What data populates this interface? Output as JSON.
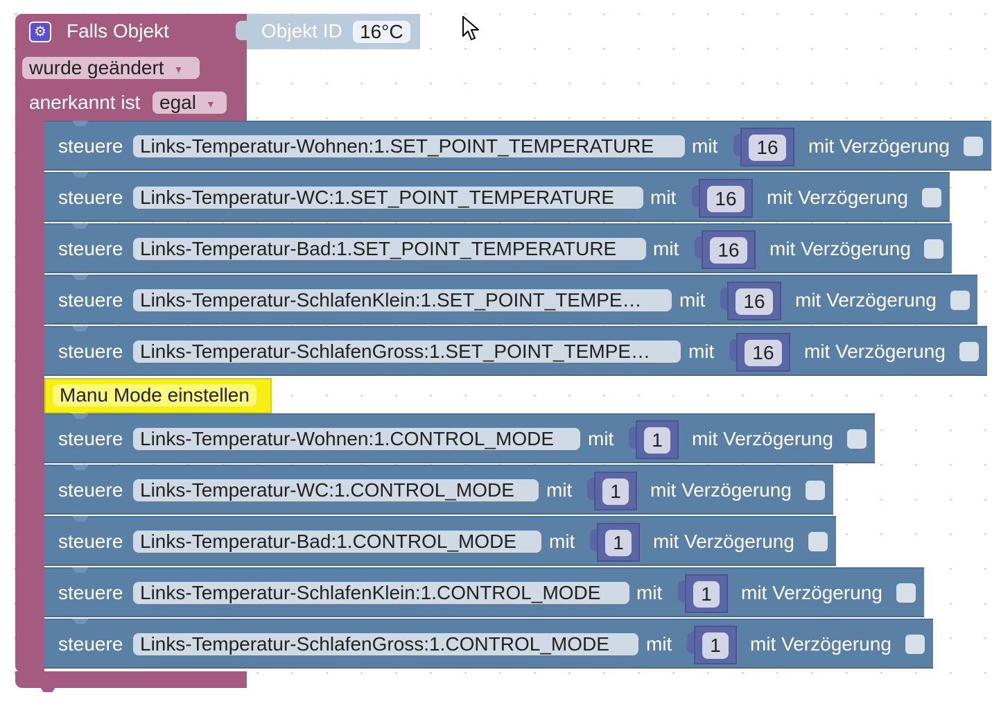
{
  "event_block": {
    "title": "Falls Objekt",
    "settings_icon": "gear-icon",
    "trigger_dropdown": "wurde geändert",
    "ack_label": "anerkannt ist",
    "ack_dropdown": "egal",
    "color": "#a55b80"
  },
  "object_input": {
    "label": "Objekt ID",
    "value": "16°C"
  },
  "comment": {
    "text": "Manu Mode einstellen",
    "color": "#f5f011"
  },
  "setpoint_rows": [
    {
      "verb": "steuere",
      "object_id": "Links-Temperatur-Wohnen:1.SET_POINT_TEMPERATURE",
      "mit": "mit",
      "value": "16",
      "delay_label": "mit Verzögerung"
    },
    {
      "verb": "steuere",
      "object_id": "Links-Temperatur-WC:1.SET_POINT_TEMPERATURE",
      "mit": "mit",
      "value": "16",
      "delay_label": "mit Verzögerung"
    },
    {
      "verb": "steuere",
      "object_id": "Links-Temperatur-Bad:1.SET_POINT_TEMPERATURE",
      "mit": "mit",
      "value": "16",
      "delay_label": "mit Verzögerung"
    },
    {
      "verb": "steuere",
      "object_id": "Links-Temperatur-SchlafenKlein:1.SET_POINT_TEMPE…",
      "mit": "mit",
      "value": "16",
      "delay_label": "mit Verzögerung"
    },
    {
      "verb": "steuere",
      "object_id": "Links-Temperatur-SchlafenGross:1.SET_POINT_TEMPE…",
      "mit": "mit",
      "value": "16",
      "delay_label": "mit Verzögerung"
    }
  ],
  "mode_rows": [
    {
      "verb": "steuere",
      "object_id": "Links-Temperatur-Wohnen:1.CONTROL_MODE",
      "mit": "mit",
      "value": "1",
      "delay_label": "mit Verzögerung"
    },
    {
      "verb": "steuere",
      "object_id": "Links-Temperatur-WC:1.CONTROL_MODE",
      "mit": "mit",
      "value": "1",
      "delay_label": "mit Verzögerung"
    },
    {
      "verb": "steuere",
      "object_id": "Links-Temperatur-Bad:1.CONTROL_MODE",
      "mit": "mit",
      "value": "1",
      "delay_label": "mit Verzögerung"
    },
    {
      "verb": "steuere",
      "object_id": "Links-Temperatur-SchlafenKlein:1.CONTROL_MODE",
      "mit": "mit",
      "value": "1",
      "delay_label": "mit Verzögerung"
    },
    {
      "verb": "steuere",
      "object_id": "Links-Temperatur-SchlafenGross:1.CONTROL_MODE",
      "mit": "mit",
      "value": "1",
      "delay_label": "mit Verzögerung"
    }
  ],
  "block_color": "#5b80a5",
  "number_color": "#5b67a5"
}
